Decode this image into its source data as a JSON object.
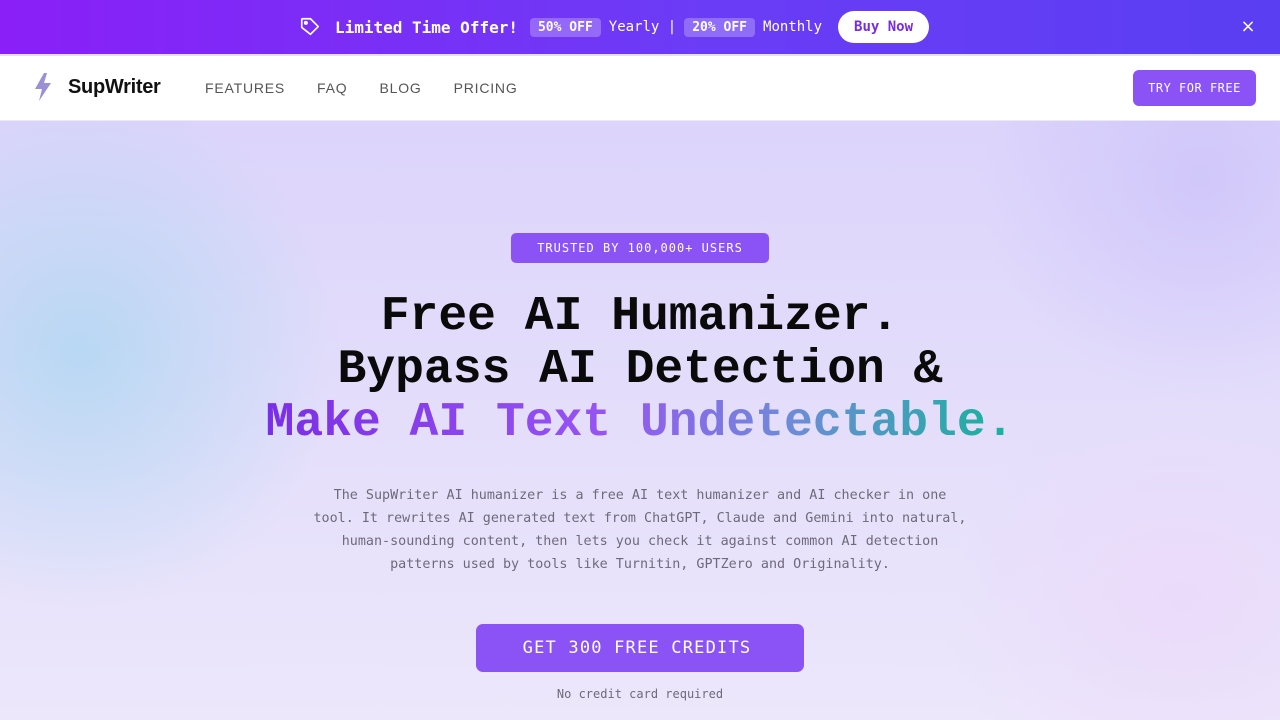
{
  "promo": {
    "title": "Limited Time Offer!",
    "yearly_pill": "50% OFF",
    "yearly_label": "Yearly |",
    "monthly_pill": "20% OFF",
    "monthly_label": "Monthly",
    "buy_label": "Buy Now",
    "close_symbol": "×",
    "icon": "tag-icon"
  },
  "nav": {
    "brand": "SupWriter",
    "logo_icon": "bolt-icon",
    "links": [
      "FEATURES",
      "FAQ",
      "BLOG",
      "PRICING"
    ],
    "cta_label": "TRY FOR FREE"
  },
  "hero": {
    "badge": "TRUSTED BY 100,000+ USERS",
    "headline_line1": "Free AI Humanizer.",
    "headline_line2": "Bypass AI Detection &",
    "headline_line3": "Make AI Text Undetectable.",
    "description": "The SupWriter AI humanizer is a free AI text humanizer and AI checker in one tool. It rewrites AI generated text from ChatGPT, Claude and Gemini into natural, human-sounding content, then lets you check it against common AI detection patterns used by tools like Turnitin, GPTZero and Originality.",
    "cta_label": "GET 300 FREE CREDITS",
    "note": "No credit card required"
  },
  "colors": {
    "accent": "#8b52f5",
    "banner_start": "#8a1ff7",
    "banner_end": "#5a3ef2"
  }
}
